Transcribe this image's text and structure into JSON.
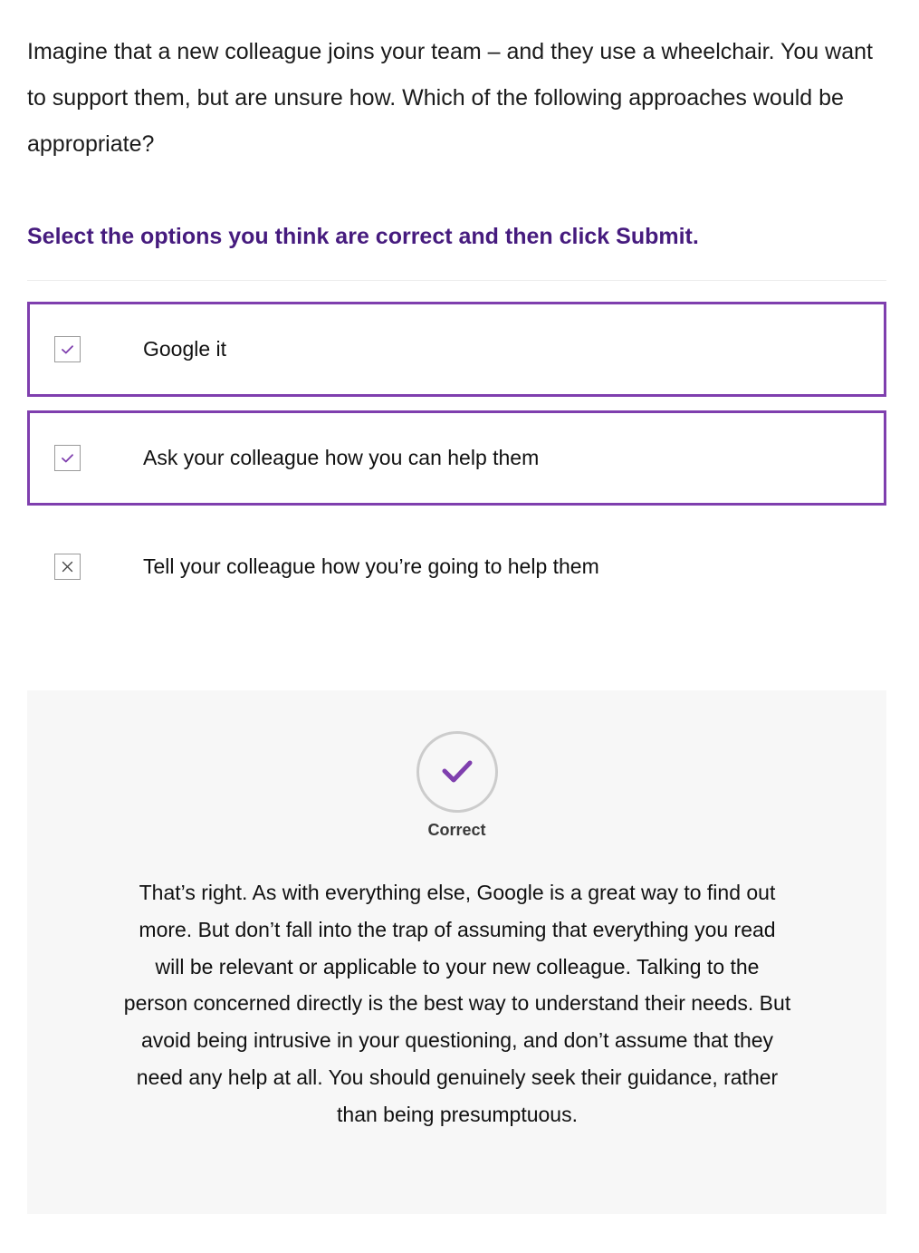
{
  "question": {
    "text": "Imagine that a new colleague joins your team – and they use a wheelchair. You want to support them, but are unsure how. Which of the following approaches would be appropriate?"
  },
  "instruction": {
    "text": "Select the options you think are correct and then click Submit."
  },
  "options": [
    {
      "label": "Google it",
      "state": "checked",
      "icon": "checkmark-icon"
    },
    {
      "label": "Ask your colleague how you can help them",
      "state": "checked",
      "icon": "checkmark-icon"
    },
    {
      "label": "Tell your colleague how you’re going to help them",
      "state": "unchecked-marked-incorrect",
      "icon": "x-mark-icon"
    }
  ],
  "feedback": {
    "status": "Correct",
    "icon": "checkmark-icon",
    "text": "That’s right. As with everything else, Google is a great way to find out more. But don’t fall into the trap of assuming that everything you read will be relevant or applicable to your new colleague. Talking to the person concerned directly is the best way to understand their needs. But avoid being intrusive in your questioning, and don’t assume that they need any help at all. You should genuinely seek their guidance, rather than being presumptuous."
  },
  "colors": {
    "accent": "#7f3fae",
    "instruction_text": "#461b7e",
    "feedback_background": "#f7f7f7"
  }
}
